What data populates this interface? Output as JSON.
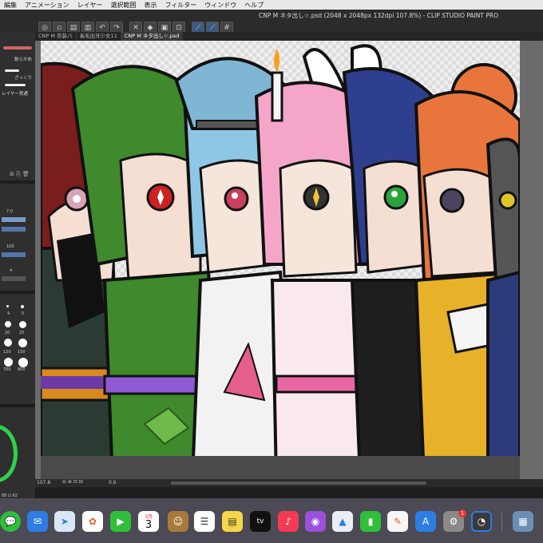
{
  "menu": {
    "items": [
      "編集",
      "アニメーション",
      "レイヤー",
      "選択範囲",
      "表示",
      "フィルター",
      "ウィンドウ",
      "ヘルプ"
    ]
  },
  "window": {
    "title": "CNP M ネタ出し☆.psd (2048 x 2048px 132dpi 107.8%) - CLIP STUDIO PAINT PRO"
  },
  "tabs": [
    {
      "label": "CNP M 衣装パ",
      "active": false
    },
    {
      "label": "長毛出牙少女11",
      "active": false
    },
    {
      "label": "CNP M ネタ出し☆.psd",
      "active": true
    }
  ],
  "brushes": [
    {
      "label": "軟らかめ"
    },
    {
      "label": "ざっくり"
    },
    {
      "label": "レイヤー貫通"
    }
  ],
  "tool_property": {
    "size_value": "7.0",
    "opacity_value": "100",
    "stabilizer_value": "4"
  },
  "brush_sizes": [
    "4",
    "5",
    "20",
    "25",
    "120",
    "150",
    "700",
    "800"
  ],
  "status": {
    "zoom": "107.8",
    "angle": "0.0",
    "coords": "88 ⊡ 62"
  },
  "dock": {
    "calendar_month": "3月",
    "calendar_day": "3",
    "tv_label": "tv",
    "settings_badge": "1"
  },
  "colors": {
    "dock_bg": "#4b4a55",
    "panel_bg": "#2f2f2f",
    "accent": "#2fd14b"
  }
}
